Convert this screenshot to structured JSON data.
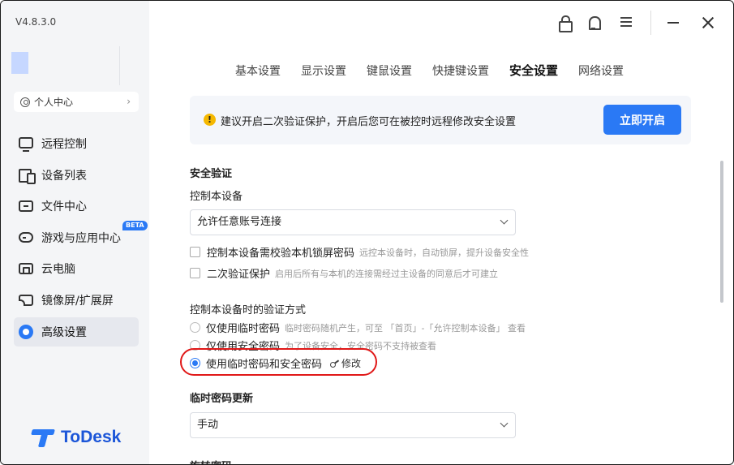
{
  "app": {
    "version": "V4.8.3.0",
    "logo_text": "ToDesk"
  },
  "sidebar": {
    "profile_label": "个人中心",
    "items": [
      {
        "label": "远程控制",
        "icon": "remote-control-icon"
      },
      {
        "label": "设备列表",
        "icon": "device-list-icon"
      },
      {
        "label": "文件中心",
        "icon": "folder-icon"
      },
      {
        "label": "游戏与应用中心",
        "icon": "gamepad-icon",
        "badge": "BETA"
      },
      {
        "label": "云电脑",
        "icon": "cloud-pc-icon"
      },
      {
        "label": "镜像屏/扩展屏",
        "icon": "screen-cast-icon"
      },
      {
        "label": "高级设置",
        "icon": "gear-icon",
        "active": true
      }
    ]
  },
  "tabs": [
    {
      "label": "基本设置"
    },
    {
      "label": "显示设置"
    },
    {
      "label": "键鼠设置"
    },
    {
      "label": "快捷键设置"
    },
    {
      "label": "安全设置",
      "active": true
    },
    {
      "label": "网络设置"
    }
  ],
  "notice": {
    "text": "建议开启二次验证保护，开启后您可在被控时远程修改安全设置",
    "button": "立即开启"
  },
  "security": {
    "title": "安全验证",
    "control_device_label": "控制本设备",
    "control_device_value": "允许任意账号连接",
    "lock_check": {
      "label": "控制本设备需校验本机锁屏密码",
      "hint": "远控本设备时，自动锁屏，提升设备安全性",
      "checked": false
    },
    "twofa_check": {
      "label": "二次验证保护",
      "hint": "启用后所有与本机的连接需经过主设备的同意后才可建立",
      "checked": false
    },
    "auth_method_label": "控制本设备时的验证方式",
    "auth_options": [
      {
        "label": "仅使用临时密码",
        "hint": "临时密码随机产生，可至 「首页」-「允许控制本设备」 查看",
        "checked": false
      },
      {
        "label": "仅使用安全密码",
        "hint": "为了设备安全，安全密码不支持被查看",
        "checked": false
      },
      {
        "label": "使用临时密码和安全密码",
        "hint": "",
        "checked": true
      }
    ],
    "edit_label": "修改",
    "temp_update_title": "临时密码更新",
    "temp_update_value": "手动",
    "next_section_partial": "旋转密码"
  },
  "colors": {
    "accent": "#2a79f5",
    "sidebar_bg": "#f4f5f7",
    "highlight": "#e01818",
    "warning": "#f5b800"
  }
}
